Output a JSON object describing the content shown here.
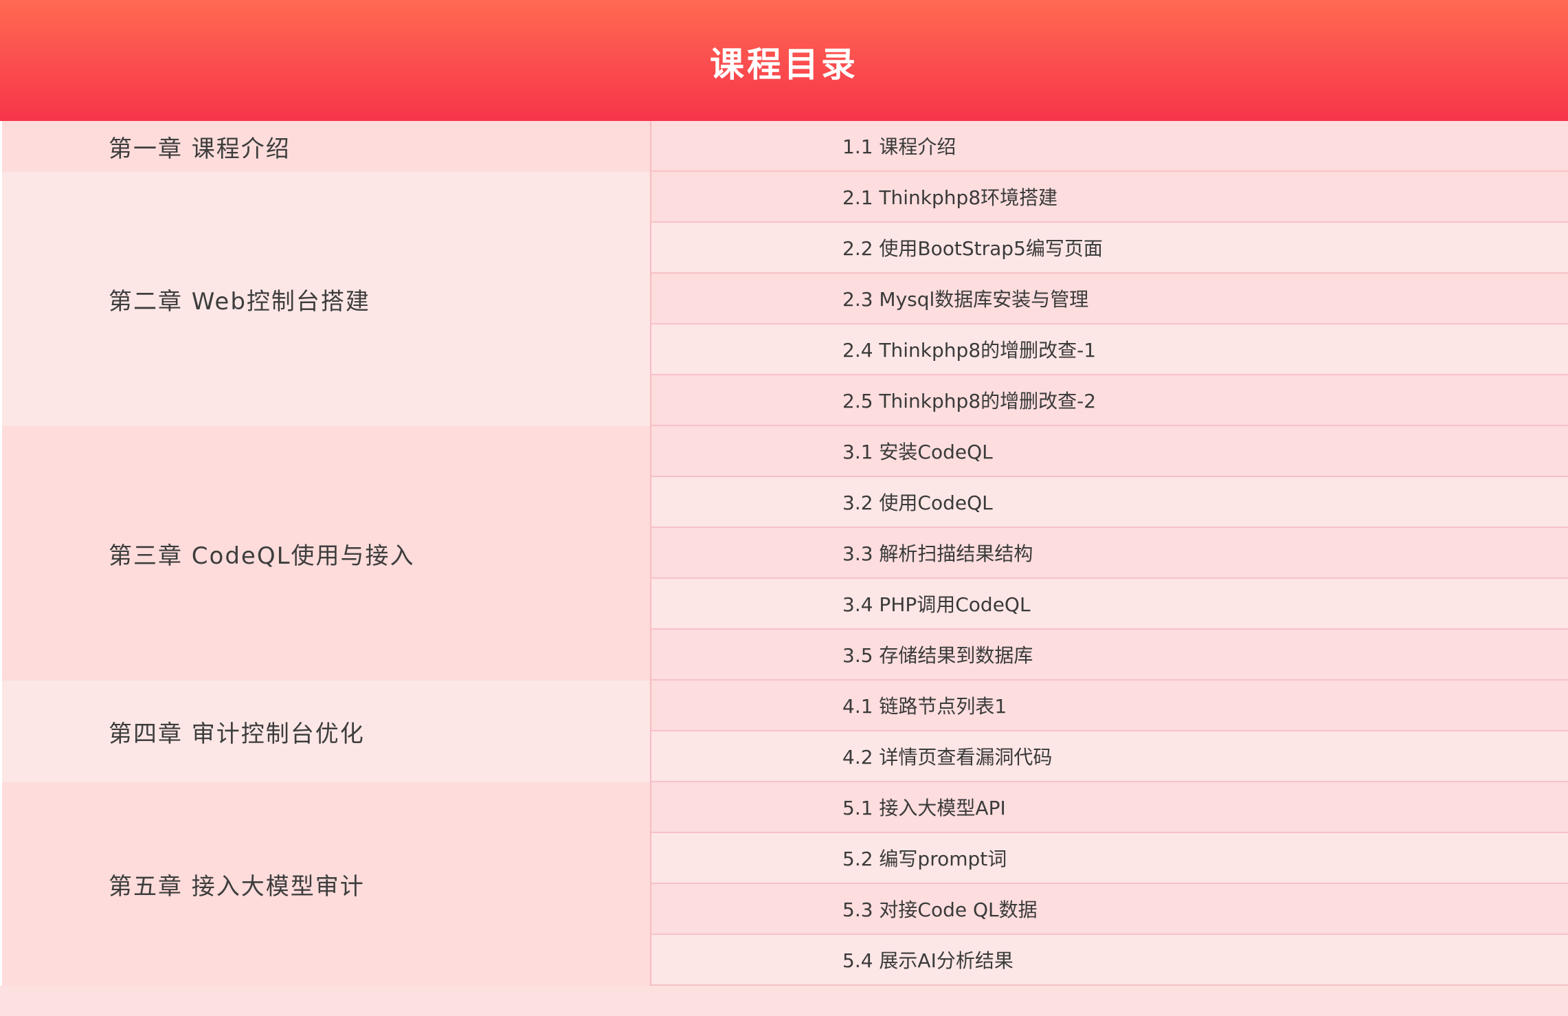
{
  "header": {
    "title": "课程目录"
  },
  "chapters": [
    {
      "title": "第一章 课程介绍",
      "lessons": [
        "1.1 课程介绍"
      ]
    },
    {
      "title": "第二章 Web控制台搭建",
      "lessons": [
        "2.1 Thinkphp8环境搭建",
        "2.2 使用BootStrap5编写页面",
        "2.3 Mysql数据库安装与管理",
        "2.4 Thinkphp8的增删改查-1",
        "2.5 Thinkphp8的增删改查-2"
      ]
    },
    {
      "title": "第三章 CodeQL使用与接入",
      "lessons": [
        "3.1 安装CodeQL",
        "3.2 使用CodeQL",
        "3.3 解析扫描结果结构",
        "3.4 PHP调用CodeQL",
        "3.5 存储结果到数据库"
      ]
    },
    {
      "title": "第四章 审计控制台优化",
      "lessons": [
        "4.1 链路节点列表1",
        "4.2 详情页查看漏洞代码"
      ]
    },
    {
      "title": "第五章 接入大模型审计",
      "lessons": [
        "5.1 接入大模型API",
        "5.2 编写prompt词",
        "5.3 对接Code QL数据",
        "5.4 展示AI分析结果"
      ]
    }
  ],
  "colors": {
    "header_top": "#ff6a52",
    "header_bottom": "#f7344a",
    "row_light": "#fde6e6",
    "row_dark": "#fddcdb",
    "divider": "#f7c1c8"
  }
}
